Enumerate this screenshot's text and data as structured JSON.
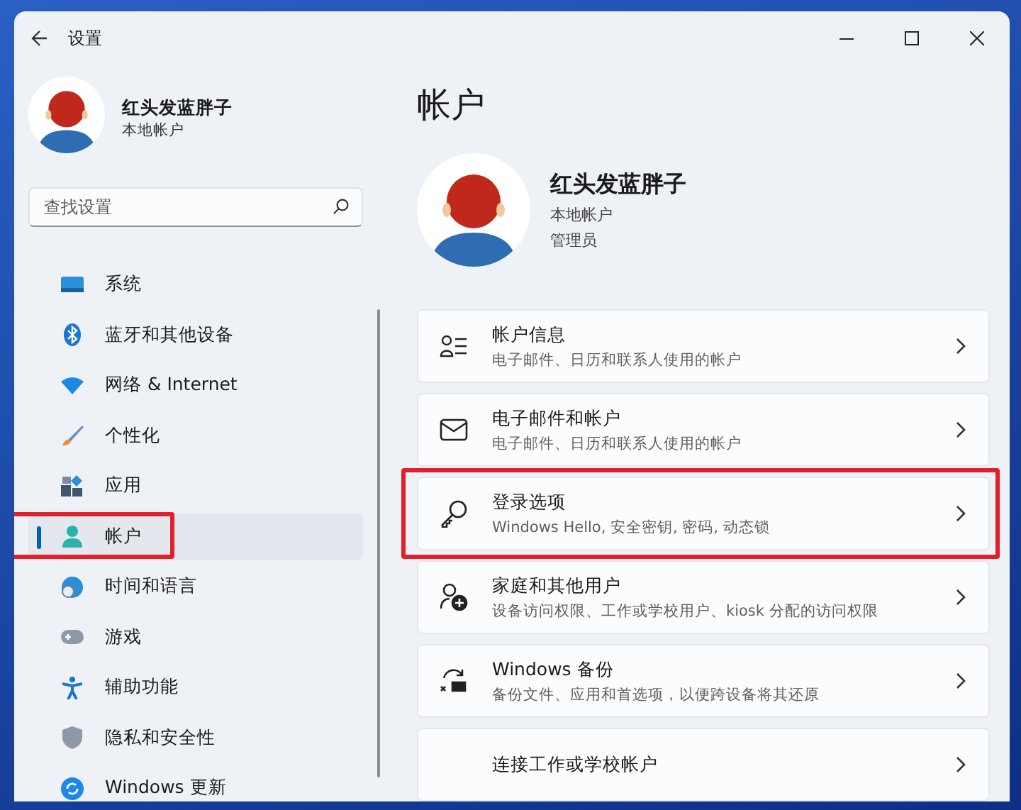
{
  "window": {
    "title": "设置"
  },
  "profile": {
    "name": "红头发蓝胖子",
    "account_type": "本地帐户"
  },
  "search": {
    "placeholder": "查找设置"
  },
  "nav_items": [
    {
      "label": "系统",
      "selected": false,
      "highlighted": false
    },
    {
      "label": "蓝牙和其他设备",
      "selected": false,
      "highlighted": false
    },
    {
      "label": "网络 & Internet",
      "selected": false,
      "highlighted": false
    },
    {
      "label": "个性化",
      "selected": false,
      "highlighted": false
    },
    {
      "label": "应用",
      "selected": false,
      "highlighted": false
    },
    {
      "label": "帐户",
      "selected": true,
      "highlighted": true
    },
    {
      "label": "时间和语言",
      "selected": false,
      "highlighted": false
    },
    {
      "label": "游戏",
      "selected": false,
      "highlighted": false
    },
    {
      "label": "辅助功能",
      "selected": false,
      "highlighted": false
    },
    {
      "label": "隐私和安全性",
      "selected": false,
      "highlighted": false
    },
    {
      "label": "Windows 更新",
      "selected": false,
      "highlighted": false
    }
  ],
  "page": {
    "title": "帐户",
    "user": {
      "name": "红头发蓝胖子",
      "account_type": "本地帐户",
      "role": "管理员"
    },
    "cards": [
      {
        "title": "帐户信息",
        "subtitle": "电子邮件、日历和联系人使用的帐户",
        "highlighted": false
      },
      {
        "title": "电子邮件和帐户",
        "subtitle": "电子邮件、日历和联系人使用的帐户",
        "highlighted": false
      },
      {
        "title": "登录选项",
        "subtitle": "Windows Hello, 安全密钥, 密码, 动态锁",
        "highlighted": true
      },
      {
        "title": "家庭和其他用户",
        "subtitle": "设备访问权限、工作或学校用户、kiosk 分配的访问权限",
        "highlighted": false
      },
      {
        "title": "Windows 备份",
        "subtitle": "备份文件、应用和首选项，以便跨设备将其还原",
        "highlighted": false
      },
      {
        "title": "连接工作或学校帐户",
        "highlighted": false
      }
    ]
  }
}
